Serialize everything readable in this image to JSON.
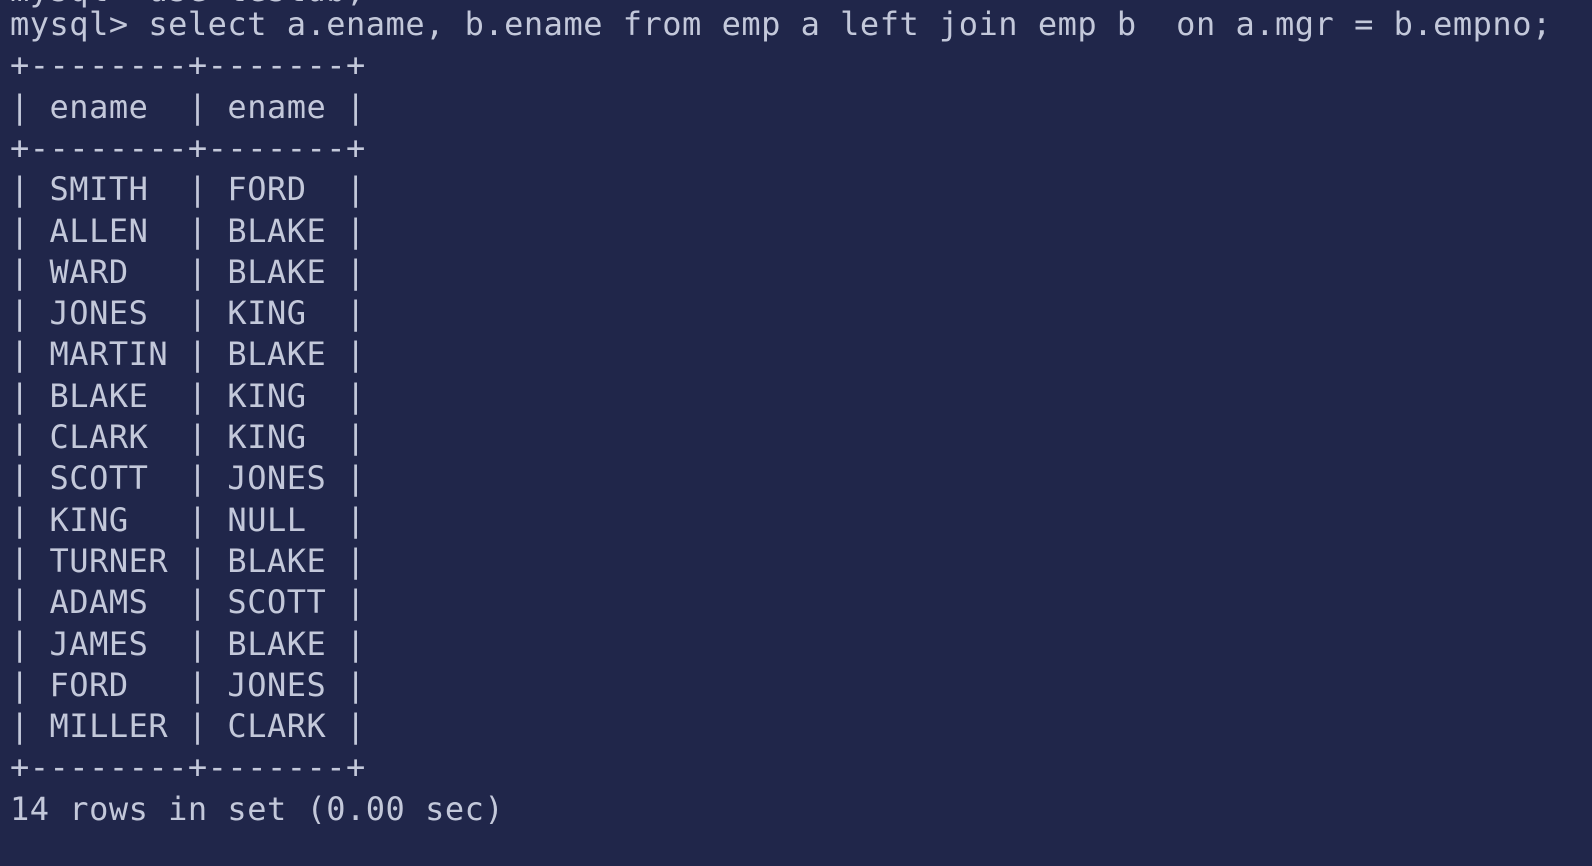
{
  "terminal": {
    "colors": {
      "background": "#20264a",
      "text": "#c3c8da"
    },
    "previous_line_partial": "mysql> use testdb;",
    "prompt": "mysql> ",
    "command": "select a.ename, b.ename from emp a left join emp b  on a.mgr = b.empno;",
    "border": "+--------+-------+",
    "columns": [
      "ename",
      "ename"
    ],
    "rows": [
      [
        "SMITH",
        "FORD"
      ],
      [
        "ALLEN",
        "BLAKE"
      ],
      [
        "WARD",
        "BLAKE"
      ],
      [
        "JONES",
        "KING"
      ],
      [
        "MARTIN",
        "BLAKE"
      ],
      [
        "BLAKE",
        "KING"
      ],
      [
        "CLARK",
        "KING"
      ],
      [
        "SCOTT",
        "JONES"
      ],
      [
        "KING",
        "NULL"
      ],
      [
        "TURNER",
        "BLAKE"
      ],
      [
        "ADAMS",
        "SCOTT"
      ],
      [
        "JAMES",
        "BLAKE"
      ],
      [
        "FORD",
        "JONES"
      ],
      [
        "MILLER",
        "CLARK"
      ]
    ],
    "summary": "14 rows in set (0.00 sec)"
  }
}
